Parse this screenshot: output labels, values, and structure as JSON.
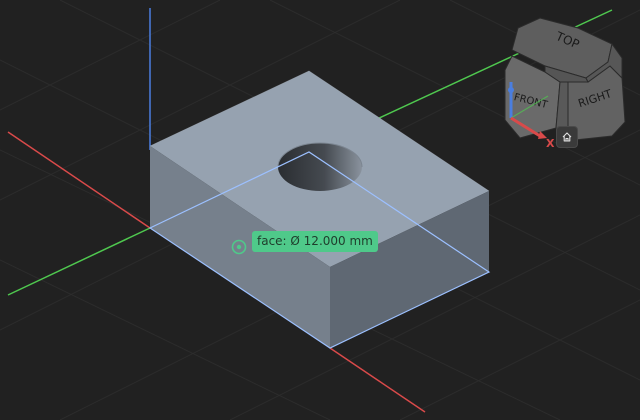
{
  "measurement": {
    "label": "face: Ø 12.000 mm"
  },
  "view_cube": {
    "faces": {
      "top": "TOP",
      "front": "FRONT",
      "right": "RIGHT"
    },
    "axis_x_label": "X"
  },
  "colors": {
    "background": "#212121",
    "grid": "#2c2c2c",
    "axis_x": "#d94a4a",
    "axis_y": "#4fc84f",
    "axis_z": "#4a7ee0",
    "part_top": "#96a2b0",
    "part_front": "#76808c",
    "part_right": "#5f6873",
    "selection": "#9cc0ff",
    "measure_marker": "#4fc98a"
  },
  "icons": {
    "home": "home-icon",
    "marker": "measure-target-icon"
  }
}
